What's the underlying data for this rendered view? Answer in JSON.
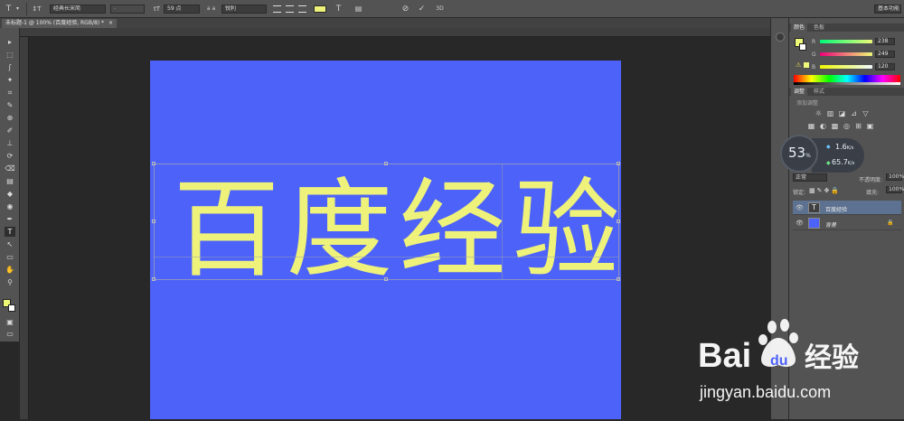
{
  "options_bar": {
    "tool_icon": "T",
    "tool_dropdown": "▾",
    "orient_icon": "↕T",
    "font_family": "经典长宋简",
    "font_style": "-",
    "size_icon": "tT",
    "font_size": "59 点",
    "aa_icon": "a a",
    "anti_alias": "锐利",
    "color_swatch": "#eef27a",
    "warp_icon": "T",
    "cancel_icon": "⊘",
    "commit_icon": "✓",
    "three_d_icon": "3D",
    "workspace": "基本功能"
  },
  "document": {
    "tab_title": "未标题-1 @ 100% (百度经验, RGB/8) *",
    "close_icon": "×"
  },
  "canvas": {
    "background": "#4d62f8",
    "text_color": "#eef27a",
    "glyphs": [
      "百",
      "度",
      "经",
      "验"
    ]
  },
  "tools": [
    "▸",
    "⬚",
    "ʃ",
    "✦",
    "⌗",
    "✎",
    "⊕",
    "✐",
    "⊥",
    "⟳",
    "⌫",
    "▤",
    "◆",
    "◉",
    "✒",
    "T",
    "↖",
    "▭",
    "✋",
    "⚲"
  ],
  "color_panel": {
    "tabs": [
      "颜色",
      "色板"
    ],
    "r_label": "R",
    "r_value": "238",
    "g_label": "G",
    "g_value": "249",
    "b_label": "B",
    "b_value": "120",
    "fg_color": "#eef978",
    "bg_color": "#ffffff"
  },
  "adjust_panel": {
    "tabs": [
      "调整",
      "样式"
    ],
    "title": "添加调整",
    "row1": [
      "☼",
      "▥",
      "◪",
      "⊿",
      "▽"
    ],
    "row2": [
      "▦",
      "◐",
      "▩",
      "◎",
      "⊞",
      "▣"
    ]
  },
  "network": {
    "percent": "53",
    "percent_unit": "%",
    "up_rate": "1.6",
    "up_unit": "K/s",
    "down_rate": "65.7",
    "down_unit": "K/s"
  },
  "layers_panel": {
    "blend_mode": "正常",
    "opacity_label": "不透明度:",
    "opacity_value": "100%",
    "lock_label": "锁定:",
    "fill_label": "填充:",
    "fill_value": "100%",
    "layers": [
      {
        "name": "百度经验",
        "thumb": "T",
        "selected": true
      },
      {
        "name": "背景",
        "thumb": "",
        "selected": false
      }
    ],
    "lock_icon": "🔒"
  },
  "watermark": {
    "brand_text": "Bai",
    "brand_text2": "du",
    "brand_cn": "经验",
    "url": "jingyan.baidu.com"
  }
}
